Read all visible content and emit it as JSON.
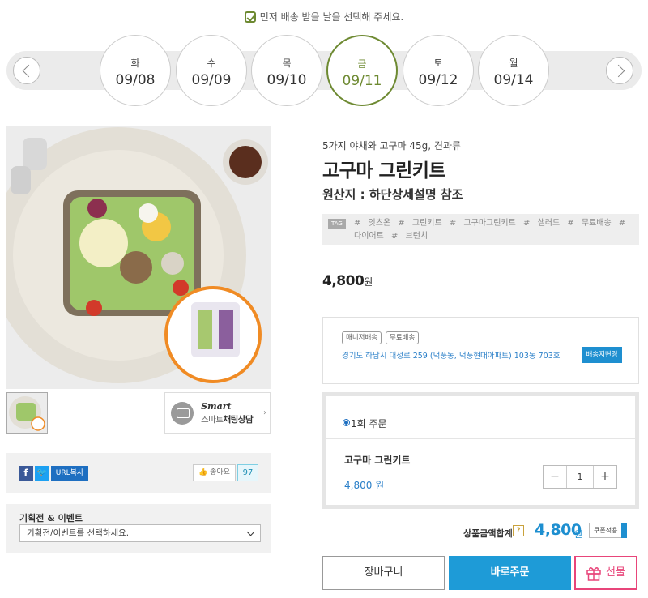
{
  "notice": "먼저 배송 받을 날을 선택해 주세요.",
  "dates": [
    {
      "dow": "화",
      "date": "09/08",
      "selected": false
    },
    {
      "dow": "수",
      "date": "09/09",
      "selected": false
    },
    {
      "dow": "목",
      "date": "09/10",
      "selected": false
    },
    {
      "dow": "금",
      "date": "09/11",
      "selected": true
    },
    {
      "dow": "토",
      "date": "09/12",
      "selected": false
    },
    {
      "dow": "월",
      "date": "09/14",
      "selected": false
    }
  ],
  "chat": {
    "smart": "Smart",
    "label_prefix": "스마트",
    "label_bold": "채팅상담"
  },
  "share": {
    "url_label": "URL복사",
    "like_label": "좋아요",
    "like_count": "97"
  },
  "event": {
    "title": "기획전 & 이벤트",
    "select_value": "기획전/이벤트를 선택하세요."
  },
  "product": {
    "subtitle": "5가지 야채와 고구마 45g, 견과류",
    "name": "고구마 그린키트",
    "origin": "원산지 : 하단상세설명 참조",
    "tag_badge": "TAG",
    "tags": "# 잇츠온 # 그린키트 # 고구마그린키트 # 샐러드 # 무료배송 # 다이어트 # 브런치",
    "price": "4,800",
    "price_unit": "원"
  },
  "shipping": {
    "tag1": "매니저배송",
    "tag2": "무료배송",
    "address": "경기도 하남시 대성로 259 (덕풍동, 덕풍현대아파트) 103동 703호",
    "change_label": "배송지변경"
  },
  "order": {
    "option_label": "1회 주문",
    "item_name": "고구마 그린키트",
    "item_price": "4,800 원",
    "minus": "−",
    "plus": "+",
    "qty": "1"
  },
  "total": {
    "label": "상품금액합계",
    "help": "?",
    "value": "4,800",
    "unit": "원",
    "coupon": "쿠폰적용"
  },
  "buttons": {
    "cart": "장바구니",
    "buy": "바로주문",
    "gift": "선물"
  },
  "colors": {
    "accent_green": "#6e8a32",
    "accent_blue": "#1e9bd7",
    "gift_pink": "#e8457a"
  }
}
